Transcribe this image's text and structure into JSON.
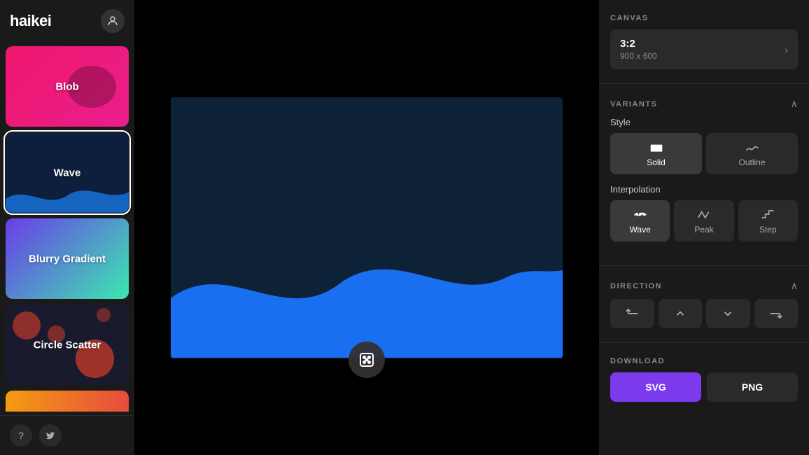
{
  "sidebar": {
    "logo": "haikei",
    "items": [
      {
        "id": "blob",
        "label": "Blob",
        "active": false
      },
      {
        "id": "wave",
        "label": "Wave",
        "active": true
      },
      {
        "id": "blurry-gradient",
        "label": "Blurry Gradient",
        "active": false
      },
      {
        "id": "circle-scatter",
        "label": "Circle Scatter",
        "active": false
      }
    ],
    "footer": {
      "help_label": "?",
      "twitter_label": "t"
    }
  },
  "canvas_section": {
    "title": "CANVAS",
    "ratio": "3:2",
    "size": "900 x 600"
  },
  "variants_section": {
    "title": "VARIANTS",
    "style_label": "Style",
    "style_options": [
      {
        "id": "solid",
        "label": "Solid",
        "active": true
      },
      {
        "id": "outline",
        "label": "Outline",
        "active": false
      }
    ],
    "interpolation_label": "Interpolation",
    "interpolation_options": [
      {
        "id": "wave",
        "label": "Wave",
        "active": true
      },
      {
        "id": "peak",
        "label": "Peak",
        "active": false
      },
      {
        "id": "step",
        "label": "Step",
        "active": false
      }
    ]
  },
  "direction_section": {
    "title": "DIRECTION",
    "options": [
      {
        "id": "left",
        "symbol": "▶|",
        "active": false
      },
      {
        "id": "up",
        "symbol": "△",
        "active": false
      },
      {
        "id": "down",
        "symbol": "▽",
        "active": false
      },
      {
        "id": "right",
        "symbol": "|◀",
        "active": false
      }
    ]
  },
  "download_section": {
    "title": "DOWNLOAD",
    "svg_label": "SVG",
    "png_label": "PNG"
  }
}
